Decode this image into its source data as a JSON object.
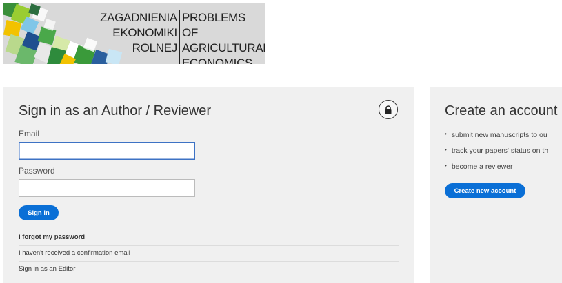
{
  "banner": {
    "title_pl": [
      "ZAGADNIENIA",
      "EKONOMIKI",
      "ROLNEJ"
    ],
    "title_en": [
      "PROBLEMS",
      "OF AGRICULTURAL",
      "ECONOMICS"
    ]
  },
  "signin": {
    "title": "Sign in as an Author / Reviewer",
    "lock_icon": "lock-icon",
    "email_label": "Email",
    "email_value": "",
    "password_label": "Password",
    "password_value": "",
    "submit_label": "Sign in",
    "links": {
      "forgot": "I forgot my password",
      "no_confirmation": "I haven't received a confirmation email",
      "editor": "Sign in as an Editor"
    }
  },
  "create": {
    "title": "Create an account",
    "bullets": [
      "submit new manuscripts to ou",
      "track your papers' status on th",
      "become a reviewer"
    ],
    "button_label": "Create new account"
  },
  "colors": {
    "accent": "#0a6fd6",
    "panel_bg": "#f0f0f0",
    "focus_border": "#3d72c4"
  }
}
